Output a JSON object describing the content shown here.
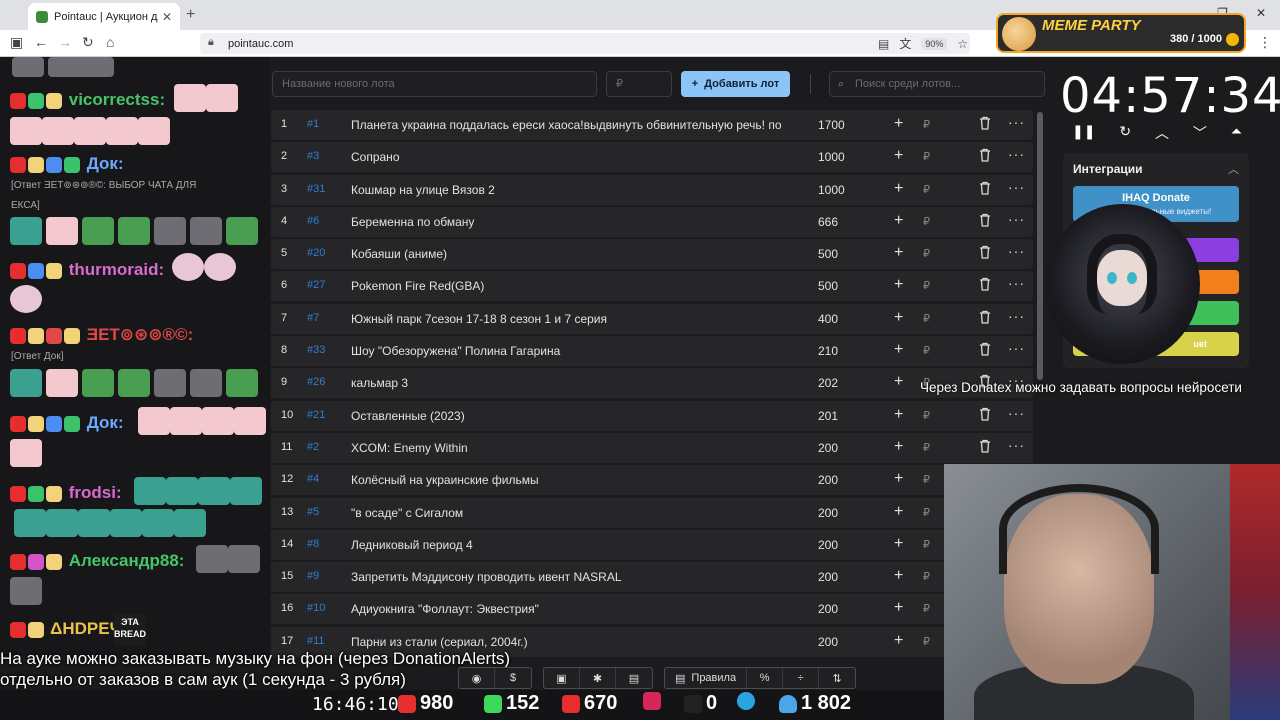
{
  "browser": {
    "tab_title": "Pointauc | Аукцион для стримера",
    "tab_close": "✕",
    "new_tab": "+",
    "url": "pointauc.com",
    "zoom": "90%",
    "window_controls": [
      "—",
      "❐",
      "✕"
    ]
  },
  "overlay": {
    "title": "MEME PARTY",
    "counter": "380 / 1000"
  },
  "chat": {
    "messages": [
      {
        "user": "vicorrectss:",
        "color": "#46c46a"
      },
      {
        "user": "Док:",
        "color": "#6ea8ff"
      },
      {
        "reply": "[Ответ ƎET⊚⊛⊚®©: ВЫБОР ЧАТА ДЛЯ"
      },
      {
        "reply2": "ЕКСА]"
      },
      {
        "user": "thurmoraid:",
        "color": "#d86ad0"
      },
      {
        "user": "ƎET⊚⊛⊚®©:",
        "color": "#e04848"
      },
      {
        "reply": "[Ответ Док]"
      },
      {
        "user": "Док:",
        "color": "#6ea8ff"
      },
      {
        "user": "frodsi:",
        "color": "#d86ad0"
      },
      {
        "user": "Александр88:",
        "color": "#46c46a"
      },
      {
        "user": "ΔHDPEЧ:",
        "color": "#e8c24a",
        "emote_label": "ЭТА BREAD"
      }
    ]
  },
  "controls": {
    "new_lot_placeholder": "Название нового лота",
    "price_placeholder": "₽",
    "add_button": "Добавить лот",
    "search_placeholder": "Поиск среди лотов..."
  },
  "lots": [
    {
      "n": "1",
      "id": "#1",
      "name": "Планета украина поддалась ереси хаоса!выдвинуть обвинительную речь! по",
      "amount": "1700"
    },
    {
      "n": "2",
      "id": "#3",
      "name": "Сопрано",
      "amount": "1000"
    },
    {
      "n": "3",
      "id": "#31",
      "name": "Кошмар на улице Вязов 2",
      "amount": "1000"
    },
    {
      "n": "4",
      "id": "#6",
      "name": "Беременна по обману",
      "amount": "666"
    },
    {
      "n": "5",
      "id": "#20",
      "name": "Кобаяши (аниме)",
      "amount": "500"
    },
    {
      "n": "6",
      "id": "#27",
      "name": "Pokemon Fire Red(GBA)",
      "amount": "500"
    },
    {
      "n": "7",
      "id": "#7",
      "name": "Южный парк 7сезон 17-18 8 сезон 1 и 7 серия",
      "amount": "400"
    },
    {
      "n": "8",
      "id": "#33",
      "name": "Шоу \"Обезоружена\" Полина Гагарина",
      "amount": "210"
    },
    {
      "n": "9",
      "id": "#26",
      "name": "кальмар 3",
      "amount": "202"
    },
    {
      "n": "10",
      "id": "#21",
      "name": "Оставленные (2023)",
      "amount": "201"
    },
    {
      "n": "11",
      "id": "#2",
      "name": "XCOM: Enemy Within",
      "amount": "200"
    },
    {
      "n": "12",
      "id": "#4",
      "name": "Колёсный на украинские фильмы",
      "amount": "200"
    },
    {
      "n": "13",
      "id": "#5",
      "name": "\"в осаде\" с Сигалом",
      "amount": "200"
    },
    {
      "n": "14",
      "id": "#8",
      "name": "Ледниковый период 4",
      "amount": "200"
    },
    {
      "n": "15",
      "id": "#9",
      "name": "Запретить Мэддисону проводить ивент NASRAL",
      "amount": "200"
    },
    {
      "n": "16",
      "id": "#10",
      "name": "Адиуокнига \"Фоллаут: Эквестрия\"",
      "amount": "200"
    },
    {
      "n": "17",
      "id": "#11",
      "name": "Парни из стали (сериал, 2004г.)",
      "amount": "200"
    }
  ],
  "lot_currency": "₽",
  "timer": "04:57:34",
  "integrations": {
    "title": "Интеграции",
    "ihaq_title": "IHAQ Donate",
    "ihaq_sub": "Крутые уникальные виджеты!",
    "bouquet": "uet",
    "bar_colors": [
      "#8b3fe0",
      "#f07f1c",
      "#3fc05a",
      "#d8d24a"
    ]
  },
  "notice": "Через Donatex можно задавать вопросы нейросети",
  "subtitle": {
    "line1": "На ауке можно заказывать музыку на фон (через DonationAlerts)",
    "line2": "отдельно от заказов в сам аук (1 секунда - 3 рубля)"
  },
  "toolbar": {
    "rules": "Правила",
    "percent": "%"
  },
  "stats": {
    "clock": "16:46:10",
    "youtube": "980",
    "kick": "152",
    "live": "670",
    "rutube": "0",
    "viewers": "1 802"
  }
}
